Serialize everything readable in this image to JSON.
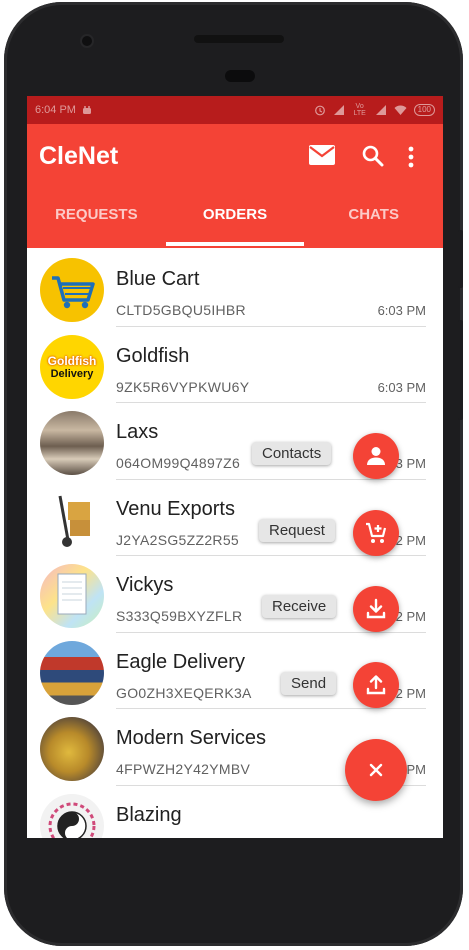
{
  "status_bar": {
    "time": "6:04 PM",
    "battery": "100",
    "signal_label": "Vo LTE"
  },
  "app": {
    "title": "CleNet"
  },
  "tabs": [
    {
      "label": "REQUESTS",
      "active": false
    },
    {
      "label": "ORDERS",
      "active": true
    },
    {
      "label": "CHATS",
      "active": false
    }
  ],
  "orders": [
    {
      "name": "Blue Cart",
      "code": "CLTD5GBQU5IHBR",
      "time": "6:03 PM"
    },
    {
      "name": "Goldfish",
      "code": "9ZK5R6VYPKWU6Y",
      "time": "6:03 PM",
      "logo_text": [
        "Goldfish",
        "Delivery"
      ]
    },
    {
      "name": "Laxs",
      "code": "064OM99Q4897Z6",
      "time": "6:03 PM"
    },
    {
      "name": "Venu Exports",
      "code": "J2YA2SG5ZZ2R55",
      "time": "6:02 PM"
    },
    {
      "name": "Vickys",
      "code": "S333Q59BXYZFLR",
      "time": "6:02 PM"
    },
    {
      "name": "Eagle Delivery",
      "code": "GO0ZH3XEQERK3A",
      "time": "6:02 PM"
    },
    {
      "name": "Modern Services",
      "code": "4FPWZH2Y42YMBV",
      "time": "6:02 PM"
    },
    {
      "name": "Blazing",
      "code": "",
      "time": ""
    }
  ],
  "fab_menu": {
    "contacts": "Contacts",
    "request": "Request",
    "receive": "Receive",
    "send": "Send"
  },
  "colors": {
    "primary": "#f44336",
    "status_bar": "#b71c1c",
    "chip_bg": "#e6e6e6"
  },
  "icons": [
    "mail-icon",
    "search-icon",
    "more-vert-icon",
    "person-icon",
    "cart-add-icon",
    "download-icon",
    "upload-icon",
    "close-icon"
  ]
}
